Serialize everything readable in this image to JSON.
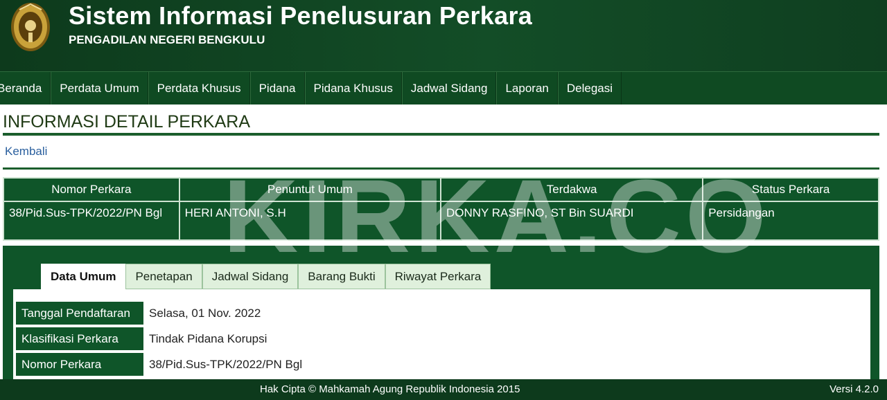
{
  "header": {
    "app_title": "Sistem Informasi Penelusuran Perkara",
    "court_name": "PENGADILAN NEGERI BENGKULU",
    "logo_icon": "mahkamah-agung-emblem-icon"
  },
  "nav": {
    "items": [
      "Beranda",
      "Perdata Umum",
      "Perdata Khusus",
      "Pidana",
      "Pidana Khusus",
      "Jadwal Sidang",
      "Laporan",
      "Delegasi"
    ]
  },
  "page": {
    "title": "INFORMASI DETAIL PERKARA",
    "back_link": "Kembali"
  },
  "case_table": {
    "headers": [
      "Nomor Perkara",
      "Penuntut Umum",
      "Terdakwa",
      "Status Perkara"
    ],
    "row": [
      "38/Pid.Sus-TPK/2022/PN Bgl",
      "HERI ANTONI, S.H",
      "DONNY RASFINO, ST Bin SUARDI",
      "Persidangan"
    ]
  },
  "tabs": {
    "items": [
      "Data Umum",
      "Penetapan",
      "Jadwal Sidang",
      "Barang Bukti",
      "Riwayat Perkara"
    ],
    "active": "Data Umum"
  },
  "detail": {
    "rows": [
      {
        "label": "Tanggal Pendaftaran",
        "value": "Selasa, 01 Nov. 2022"
      },
      {
        "label": "Klasifikasi Perkara",
        "value": "Tindak Pidana Korupsi"
      },
      {
        "label": "Nomor Perkara",
        "value": "38/Pid.Sus-TPK/2022/PN Bgl"
      }
    ]
  },
  "footer": {
    "copyright": "Hak Cipta © Mahkamah Agung Republik Indonesia 2015",
    "version": "Versi 4.2.0"
  },
  "watermark": "KIRKA.CO",
  "colors": {
    "header_bg": "#134d27",
    "nav_bg": "#0f4a22",
    "table_bg": "#0f5529",
    "tab_bg": "#dff0dc",
    "link": "#2a5f9e"
  }
}
